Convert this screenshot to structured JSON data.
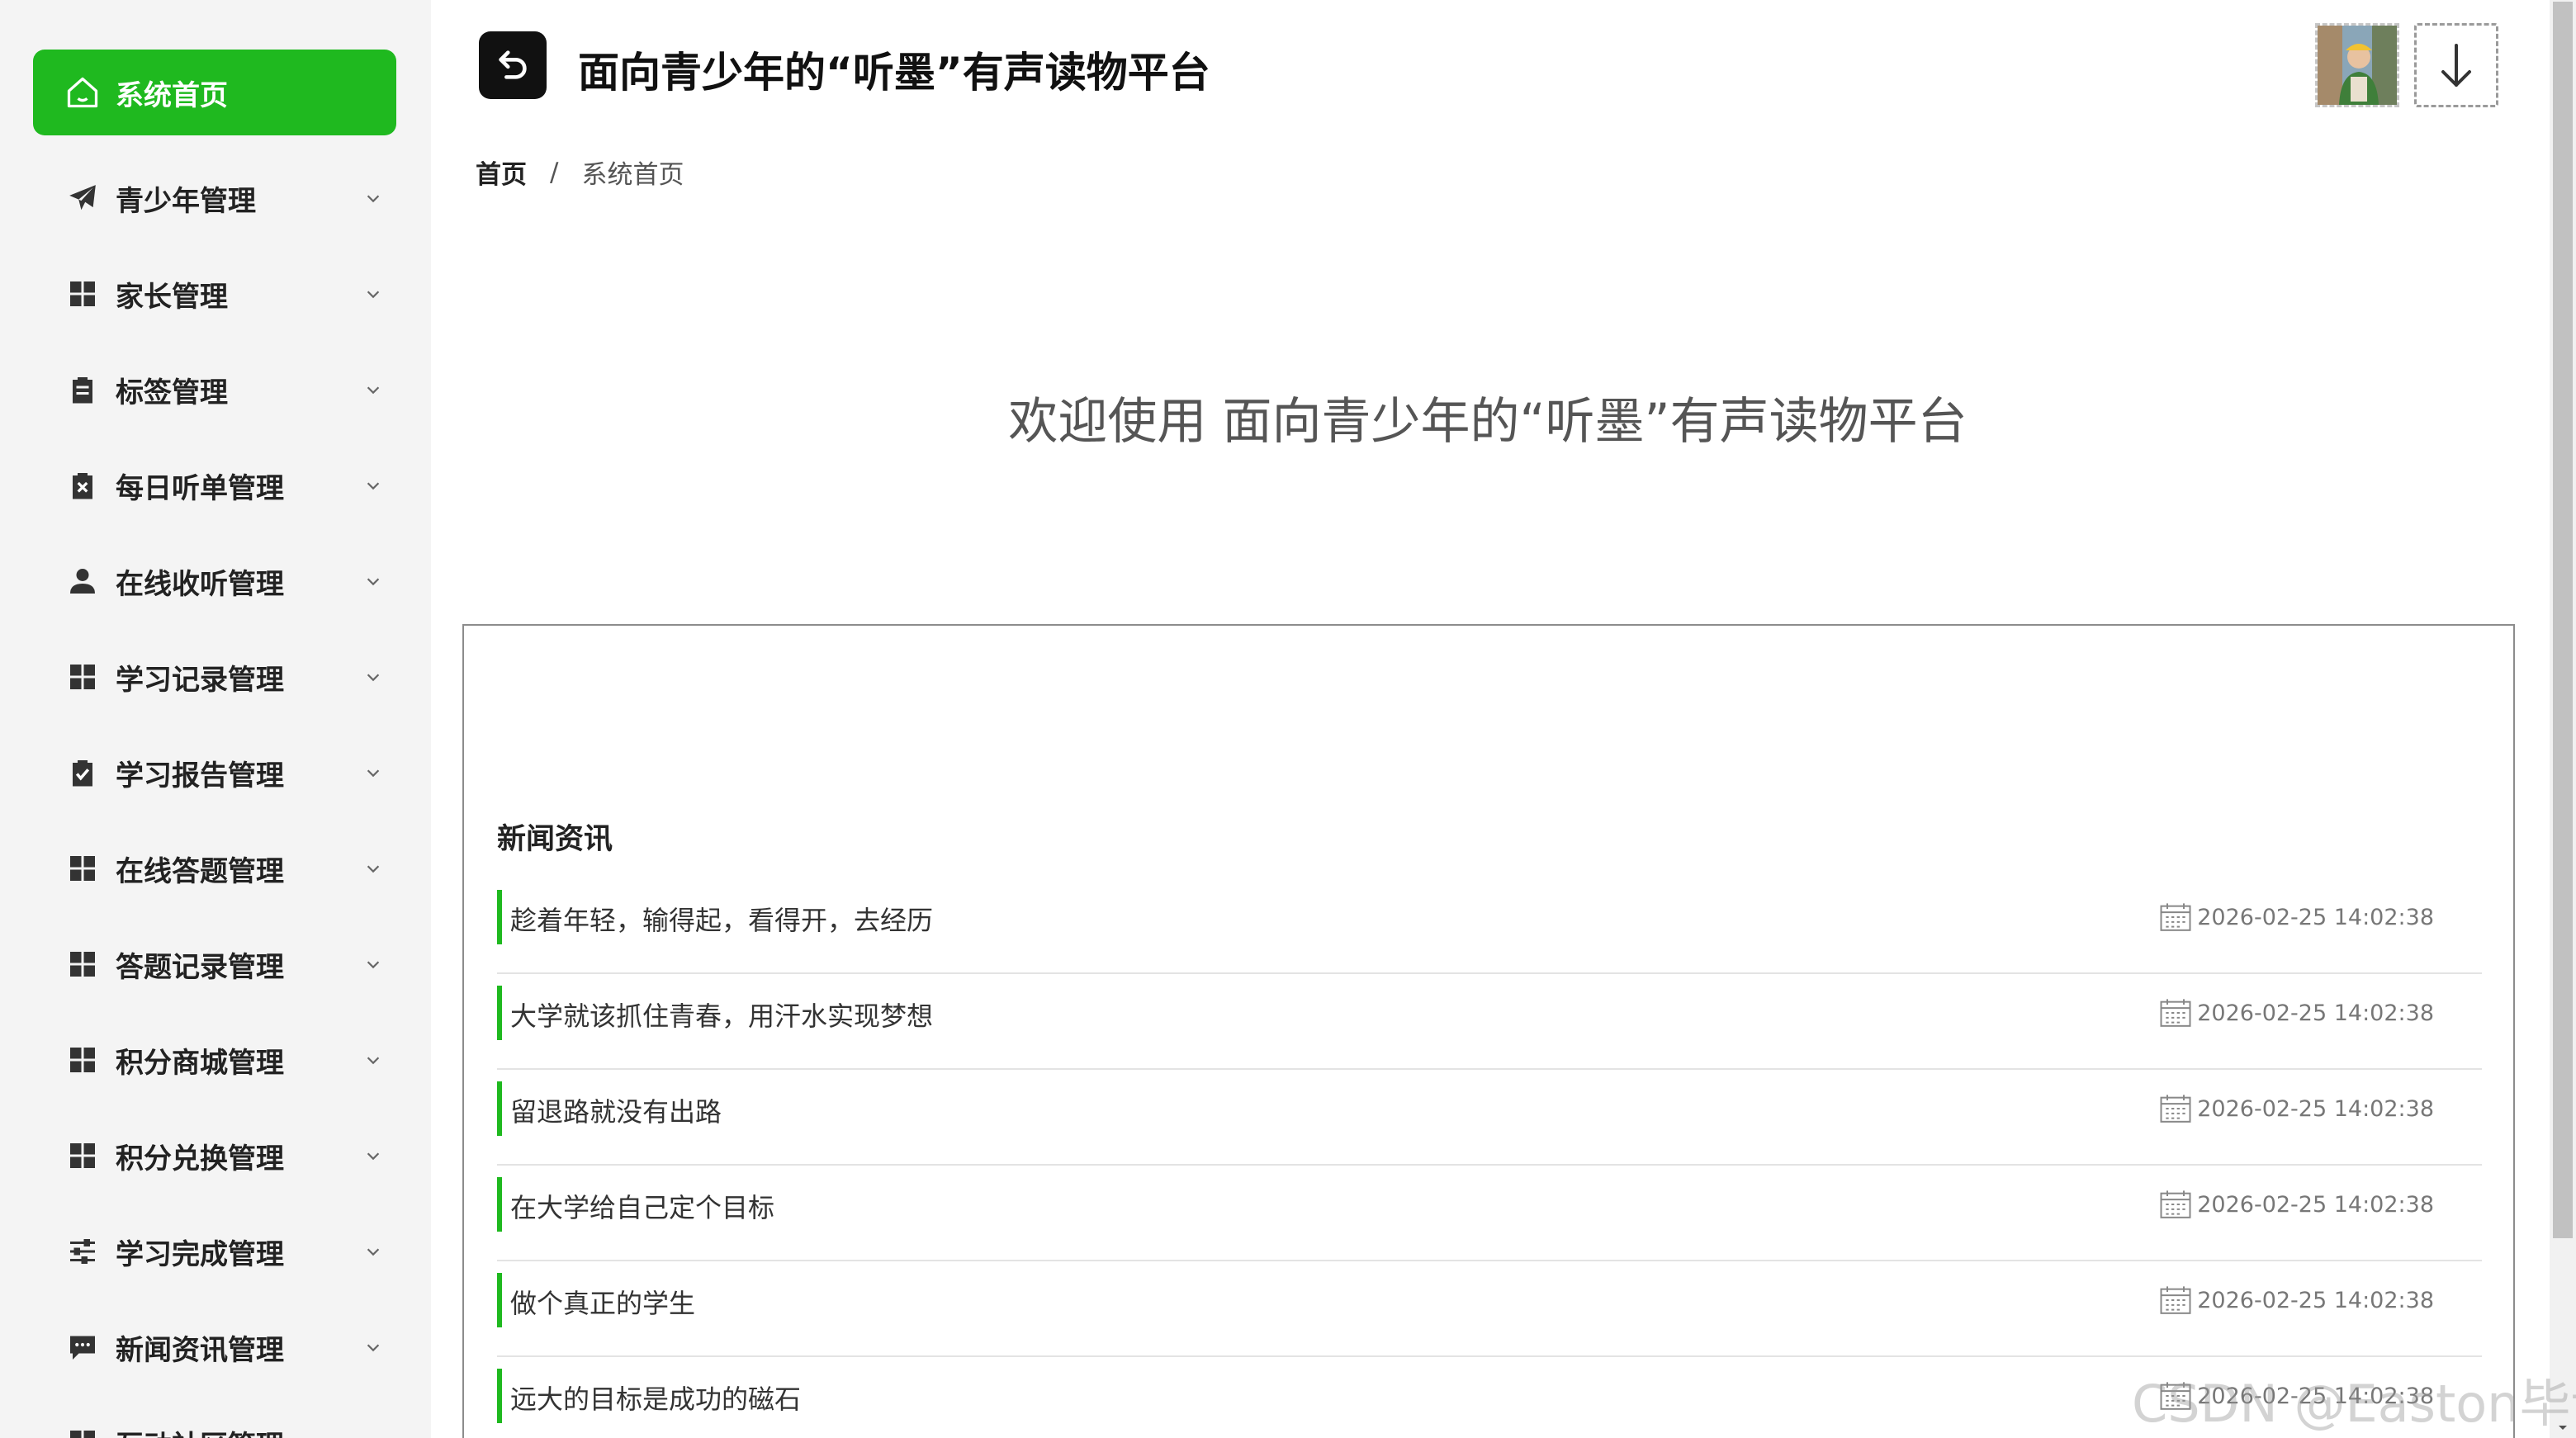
{
  "app": {
    "title": "面向青少年的“听墨”有声读物平台",
    "accent_color": "#1fb91f"
  },
  "sidebar": {
    "active": {
      "label": "系统首页",
      "icon": "home-icon"
    },
    "items": [
      {
        "label": "青少年管理",
        "icon": "paper-plane-icon"
      },
      {
        "label": "家长管理",
        "icon": "grid-icon"
      },
      {
        "label": "标签管理",
        "icon": "clipboard-icon"
      },
      {
        "label": "每日听单管理",
        "icon": "clipboard-x-icon"
      },
      {
        "label": "在线收听管理",
        "icon": "user-icon"
      },
      {
        "label": "学习记录管理",
        "icon": "grid-icon"
      },
      {
        "label": "学习报告管理",
        "icon": "clipboard-check-icon"
      },
      {
        "label": "在线答题管理",
        "icon": "grid-icon"
      },
      {
        "label": "答题记录管理",
        "icon": "grid-icon"
      },
      {
        "label": "积分商城管理",
        "icon": "grid-icon"
      },
      {
        "label": "积分兑换管理",
        "icon": "grid-icon"
      },
      {
        "label": "学习完成管理",
        "icon": "sliders-icon"
      },
      {
        "label": "新闻资讯管理",
        "icon": "chat-icon"
      },
      {
        "label": "互动社区管理",
        "icon": "grid-icon"
      }
    ]
  },
  "breadcrumb": {
    "home": "首页",
    "separator": "/",
    "current": "系统首页"
  },
  "welcome": {
    "text": "欢迎使用 面向青少年的“听墨”有声读物平台"
  },
  "news": {
    "heading": "新闻资讯",
    "items": [
      {
        "title": "趁着年轻，输得起，看得开，去经历",
        "date": "2026-02-25 14:02:38"
      },
      {
        "title": "大学就该抓住青春，用汗水实现梦想",
        "date": "2026-02-25 14:02:38"
      },
      {
        "title": "留退路就没有出路",
        "date": "2026-02-25 14:02:38"
      },
      {
        "title": "在大学给自己定个目标",
        "date": "2026-02-25 14:02:38"
      },
      {
        "title": "做个真正的学生",
        "date": "2026-02-25 14:02:38"
      },
      {
        "title": "远大的目标是成功的磁石",
        "date": "2026-02-25 14:02:38"
      }
    ]
  },
  "watermark": "CSDN @Easton毕设"
}
